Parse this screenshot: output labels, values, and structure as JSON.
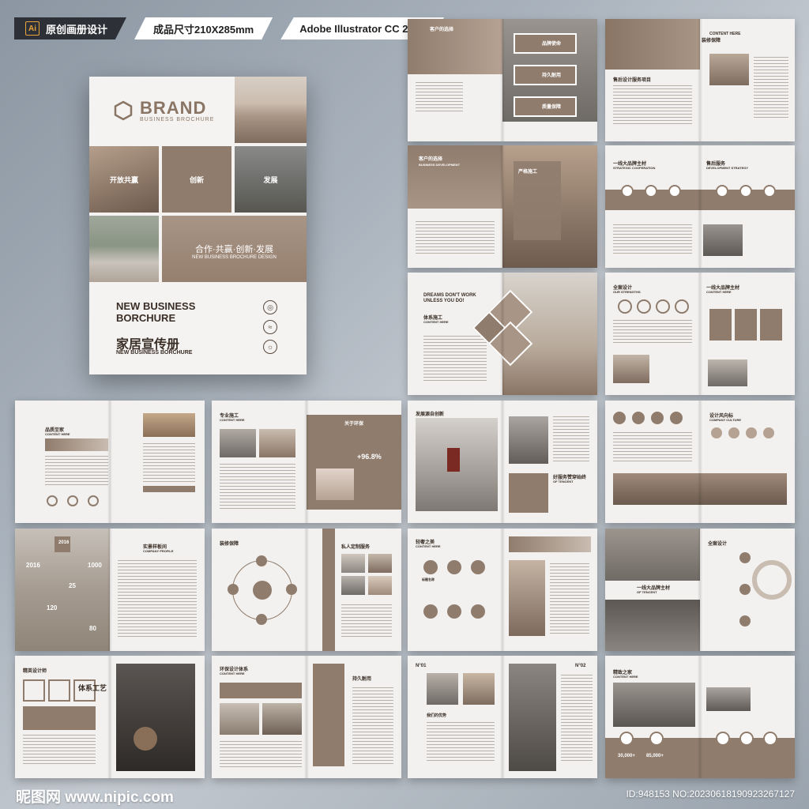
{
  "header": {
    "ai_icon_label": "Ai",
    "tag1": "原创画册设计",
    "tag2": "成品尺寸210X285mm",
    "tag3": "Adobe Illustrator CC 2018"
  },
  "cover": {
    "brand": "BRAND",
    "brand_sub": "BUSINESS BROCHURE",
    "label_open": "开放共赢",
    "label_innovate": "创新",
    "label_develop": "发展",
    "slogan": "合作·共赢·创新·发展",
    "slogan_sub": "NEW BUSINESS BROCHURE DESIGN",
    "title_line1": "NEW BUSINESS",
    "title_line2": "BORCHURE",
    "title_cn": "家居宣传册",
    "title_cn_sub": "NEW BUSINESS BORCHURE"
  },
  "spreads": [
    {
      "t1": "客户的选择",
      "t2": "品牌使命",
      "t3": "持久耐用",
      "t4": "质量保障"
    },
    {
      "t1": "装修保障",
      "t2": "CONTENT HERE",
      "t3": "售后设计服务项目"
    },
    {
      "t1": "客户的选择",
      "t2": "BUSINESS DEVELOPMENT",
      "t3": "严格施工"
    },
    {
      "t1": "一线大品牌主材",
      "t2": "STRATEGIC COOPERATION",
      "t3": "售后服务",
      "t4": "DEVELOPMENT STRATEGY"
    },
    {
      "t1": "DREAMS DON'T WORK",
      "t2": "UNLESS YOU DO!",
      "t3": "体系施工",
      "t4": "CONTENT HERE"
    },
    {
      "t1": "全案设计",
      "t2": "OUR STRENGTHS",
      "t3": "一线大品牌主材",
      "t4": "CONTENT HERE"
    },
    {
      "t1": "品质至家",
      "t2": "CONTENT HERE"
    },
    {
      "t1": "专业施工",
      "t2": "CONTENT HERE",
      "t3": "关于环保",
      "t4": "+96.8%"
    },
    {
      "t1": "发展源自创新",
      "t2": "好服务赞穿始终",
      "t3": "OF TENCENT"
    },
    {
      "t1": "设计风向标",
      "t2": "COMPANY CULTURE"
    },
    {
      "t1": "2016",
      "t2": "1000",
      "t3": "25",
      "t4": "120",
      "t5": "80",
      "t6": "实景样板间",
      "t7": "COMPANY PROFILE"
    },
    {
      "t1": "装修保障",
      "t2": "私人定制服务"
    },
    {
      "t1": "轻奢之美",
      "t2": "CONTENT HERE",
      "t3": "标题名称"
    },
    {
      "t1": "全案设计",
      "t2": "一线大品牌主材",
      "t3": "OF TENCENT"
    },
    {
      "t1": "精英设计师",
      "t2": "体系工艺"
    },
    {
      "t1": "环保设计体系",
      "t2": "CONTENT HERE",
      "t3": "持久耐用"
    },
    {
      "t1": "N°01",
      "t2": "N°02",
      "t3": "我们的优势"
    },
    {
      "t1": "精致之家",
      "t2": "CONTENT HERE",
      "t3": "30,000+",
      "t4": "85,000+"
    }
  ],
  "footer": {
    "logo": "昵图网 www.nipic.com",
    "id": "ID:948153 NO:20230618190923267127"
  },
  "colors": {
    "accent": "#8f7c6d",
    "dark": "#3a2e26",
    "bg": "#aab3bd"
  }
}
